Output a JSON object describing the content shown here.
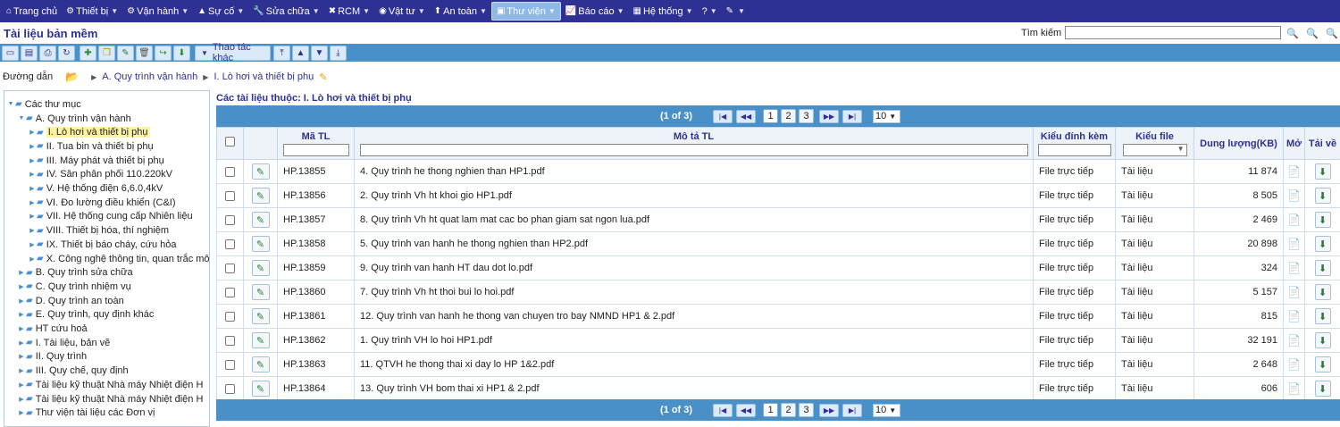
{
  "nav": {
    "items": [
      {
        "label": "Trang chủ",
        "icon": "home-icon",
        "glyph": "⌂",
        "caret": false
      },
      {
        "label": "Thiết bị",
        "icon": "equipment-icon",
        "glyph": "⚙",
        "caret": true
      },
      {
        "label": "Vận hành",
        "icon": "gears-icon",
        "glyph": "⚙",
        "caret": true
      },
      {
        "label": "Sự cố",
        "icon": "warning-icon",
        "glyph": "▲",
        "caret": true
      },
      {
        "label": "Sửa chữa",
        "icon": "wrench-icon",
        "glyph": "🔧",
        "caret": true
      },
      {
        "label": "RCM",
        "icon": "tools-icon",
        "glyph": "✖",
        "caret": true
      },
      {
        "label": "Vật tư",
        "icon": "globe-icon",
        "glyph": "◉",
        "caret": true
      },
      {
        "label": "An toàn",
        "icon": "pin-icon",
        "glyph": "⬆",
        "caret": true
      },
      {
        "label": "Thư viện",
        "icon": "library-icon",
        "glyph": "▣",
        "caret": true,
        "active": true
      },
      {
        "label": "Báo cáo",
        "icon": "chart-icon",
        "glyph": "📈",
        "caret": true
      },
      {
        "label": "Hệ thống",
        "icon": "grid-icon",
        "glyph": "▦",
        "caret": true
      },
      {
        "label": "?",
        "icon": "help-icon",
        "glyph": "",
        "caret": true
      },
      {
        "label": "",
        "icon": "brush-icon",
        "glyph": "✎",
        "caret": true
      }
    ]
  },
  "header": {
    "title": "Tài liệu bản mềm",
    "search_label": "Tìm kiếm",
    "search_value": ""
  },
  "toolbar": {
    "more_actions_label": "Thao tác khác"
  },
  "breadcrumb": {
    "label": "Đường dẫn",
    "items": [
      "A. Quy trình vận hành",
      "I. Lò hơi và thiết bị phụ"
    ]
  },
  "tree": {
    "root": "Các thư mục",
    "nodes": [
      {
        "label": "A. Quy trình vận hành",
        "level": 1,
        "open": true
      },
      {
        "label": "I. Lò hơi và thiết bị phụ",
        "level": 2,
        "selected": true
      },
      {
        "label": "II. Tua bin và thiết bị phụ",
        "level": 2
      },
      {
        "label": "III. Máy phát và thiết bị phụ",
        "level": 2
      },
      {
        "label": "IV. Sân phân phối 110.220kV",
        "level": 2
      },
      {
        "label": "V. Hệ thống điện 6,6.0,4kV",
        "level": 2
      },
      {
        "label": "VI. Đo lường điều khiển (C&I)",
        "level": 2
      },
      {
        "label": "VII. Hệ thống cung cấp Nhiên liệu",
        "level": 2
      },
      {
        "label": "VIII. Thiết bị hóa, thí nghiệm",
        "level": 2
      },
      {
        "label": "IX. Thiết bị báo cháy, cứu hỏa",
        "level": 2
      },
      {
        "label": "X. Công nghệ thông tin, quan trắc môi",
        "level": 2
      },
      {
        "label": "B. Quy trình sửa chữa",
        "level": 1
      },
      {
        "label": "C. Quy trình nhiệm vụ",
        "level": 1
      },
      {
        "label": "D. Quy trình an toàn",
        "level": 1
      },
      {
        "label": "E. Quy trình, quy định khác",
        "level": 1
      },
      {
        "label": "HT cứu hoả",
        "level": 1
      },
      {
        "label": "I. Tài liệu, bản vẽ",
        "level": 1
      },
      {
        "label": "II. Quy trình",
        "level": 1
      },
      {
        "label": "III. Quy chế, quy định",
        "level": 1
      },
      {
        "label": "Tài liệu kỹ thuật Nhà máy Nhiệt điện H",
        "level": 1
      },
      {
        "label": "Tài liệu kỹ thuật Nhà máy Nhiệt điện H",
        "level": 1
      },
      {
        "label": "Thư viện tài liệu các Đơn vị",
        "level": 1
      }
    ]
  },
  "main": {
    "caption": "Các tài liệu thuộc: I. Lò hơi và thiết bị phụ",
    "pager": {
      "info": "(1 of 3)",
      "pages": [
        "1",
        "2",
        "3"
      ],
      "current": "1",
      "page_size": "10"
    },
    "columns": {
      "code": "Mã TL",
      "desc": "Mô tả TL",
      "attach": "Kiểu đính kèm",
      "filetype": "Kiểu file",
      "size": "Dung lượng(KB)",
      "open": "Mở",
      "download": "Tải về"
    },
    "rows": [
      {
        "code": "HP.13855",
        "desc": "4. Quy trình he thong nghien than HP1.pdf",
        "attach": "File trực tiếp",
        "filetype": "Tài liệu",
        "size": "11 874"
      },
      {
        "code": "HP.13856",
        "desc": "2. Quy trình Vh ht khoi gio HP1.pdf",
        "attach": "File trực tiếp",
        "filetype": "Tài liệu",
        "size": "8 505"
      },
      {
        "code": "HP.13857",
        "desc": "8. Quy trình Vh ht quat lam mat cac bo phan giam sat ngon lua.pdf",
        "attach": "File trực tiếp",
        "filetype": "Tài liệu",
        "size": "2 469"
      },
      {
        "code": "HP.13858",
        "desc": "5. Quy trình van hanh he thong nghien than HP2.pdf",
        "attach": "File trực tiếp",
        "filetype": "Tài liệu",
        "size": "20 898"
      },
      {
        "code": "HP.13859",
        "desc": "9. Quy trình van hanh HT dau dot lo.pdf",
        "attach": "File trực tiếp",
        "filetype": "Tài liệu",
        "size": "324"
      },
      {
        "code": "HP.13860",
        "desc": "7. Quy trình Vh ht thoi bui lo hoi.pdf",
        "attach": "File trực tiếp",
        "filetype": "Tài liệu",
        "size": "5 157"
      },
      {
        "code": "HP.13861",
        "desc": "12. Quy trình van hanh he thong van chuyen tro bay NMND HP1 & 2.pdf",
        "attach": "File trực tiếp",
        "filetype": "Tài liệu",
        "size": "815"
      },
      {
        "code": "HP.13862",
        "desc": "1. Quy trình VH lo hoi HP1.pdf",
        "attach": "File trực tiếp",
        "filetype": "Tài liệu",
        "size": "32 191"
      },
      {
        "code": "HP.13863",
        "desc": "11. QTVH he thong thai xi day lo HP 1&2.pdf",
        "attach": "File trực tiếp",
        "filetype": "Tài liệu",
        "size": "2 648"
      },
      {
        "code": "HP.13864",
        "desc": "13. Quy trình VH bom thai xi HP1 & 2.pdf",
        "attach": "File trực tiếp",
        "filetype": "Tài liệu",
        "size": "606"
      }
    ]
  },
  "colors": {
    "nav_bg": "#2e3192",
    "toolbar_bg": "#4a90c8",
    "active_tab": "#8fb7e8"
  }
}
